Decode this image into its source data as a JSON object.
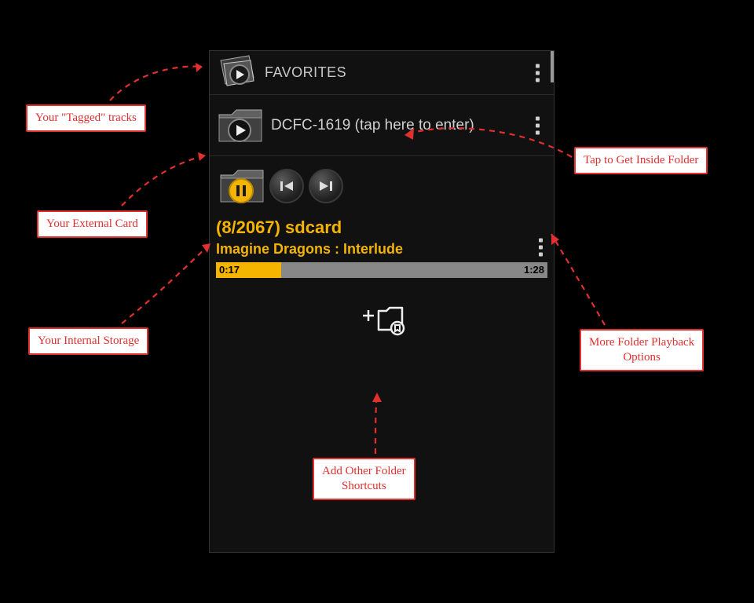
{
  "header": {
    "favorites_label": "FAVORITES"
  },
  "folder_row": {
    "label": "DCFC-1619 (tap here to enter)"
  },
  "player": {
    "count_line": "(8/2067)  sdcard",
    "track_line": "Imagine Dragons : Interlude",
    "elapsed": "0:17",
    "total": "1:28",
    "progress_pct": 19.7
  },
  "callouts": {
    "tagged": "Your \"Tagged\" tracks",
    "external": "Your External Card",
    "internal": "Your Internal Storage",
    "tap_inside": "Tap to Get Inside Folder",
    "more_options": "More Folder Playback\nOptions",
    "add_shortcuts": "Add Other Folder\nShortcuts"
  },
  "colors": {
    "accent": "#f5b400",
    "callout": "#e03030"
  }
}
